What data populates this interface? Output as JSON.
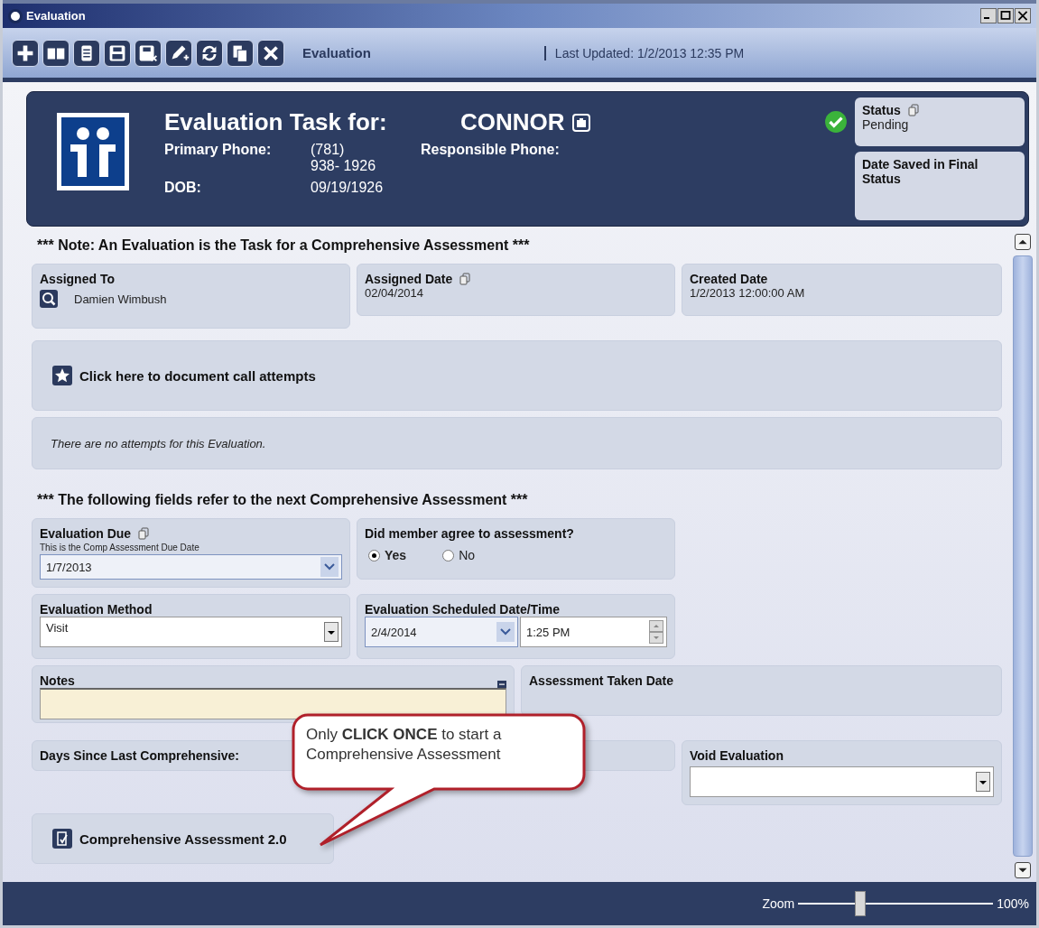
{
  "window": {
    "title": "Evaluation"
  },
  "toolbar": {
    "buttons": [
      {
        "kind": "add"
      },
      {
        "kind": "book"
      },
      {
        "kind": "document"
      },
      {
        "kind": "save"
      },
      {
        "kind": "save-close"
      },
      {
        "kind": "edit"
      },
      {
        "kind": "refresh"
      },
      {
        "kind": "copy"
      },
      {
        "kind": "close"
      }
    ],
    "title": "Evaluation",
    "last_updated": "Last Updated: 1/2/2013 12:35 PM"
  },
  "header": {
    "title": "Evaluation Task for:",
    "member": "CONNOR",
    "primary_phone_label": "Primary Phone:",
    "primary_phone": [
      "(781)",
      "938- 1926"
    ],
    "responsible_phone_label": "Responsible Phone:",
    "dob_label": "DOB:",
    "dob": "09/19/1926",
    "complete": true,
    "status_label": "Status",
    "status": "Pending",
    "date_saved_label": "Date Saved in Final Status"
  },
  "note_top": "*** Note: An Evaluation is the Task for a Comprehensive Assessment ***",
  "assigned_to": {
    "label": "Assigned To",
    "value": "Damien Wimbush"
  },
  "assigned_date": {
    "label": "Assigned Date",
    "value": "02/04/2014"
  },
  "created_date": {
    "label": "Created Date",
    "value": "1/2/2013 12:00:00 AM"
  },
  "call_attempts": {
    "label": "Click here to document call attempts",
    "empty": "There are no attempts for this Evaluation."
  },
  "note_next": "*** The following fields refer to the next Comprehensive Assessment ***",
  "evaluation_due": {
    "label": "Evaluation Due",
    "hint": "This is the Comp Assessment Due Date",
    "value": "1/7/2013"
  },
  "agree": {
    "label": "Did member agree to assessment?",
    "options": [
      {
        "label": "Yes",
        "selected": true
      },
      {
        "label": "No",
        "selected": false
      }
    ]
  },
  "evaluation_method": {
    "label": "Evaluation Method",
    "value": "Visit"
  },
  "scheduled": {
    "label": "Evaluation Scheduled Date/Time",
    "date": "2/4/2014",
    "time": "1:25 PM"
  },
  "notes": {
    "label": "Notes"
  },
  "assessment_taken": {
    "label": "Assessment Taken Date"
  },
  "days_since": {
    "label": "Days Since Last Comprehensive:"
  },
  "void_evaluation": {
    "label": "Void Evaluation"
  },
  "assessment_link": "Comprehensive Assessment 2.0",
  "callout": "Only **CLICK ONCE** to start a Comprehensive Assessment",
  "zoom": {
    "label": "Zoom",
    "level": 0.32,
    "value": "100%"
  }
}
